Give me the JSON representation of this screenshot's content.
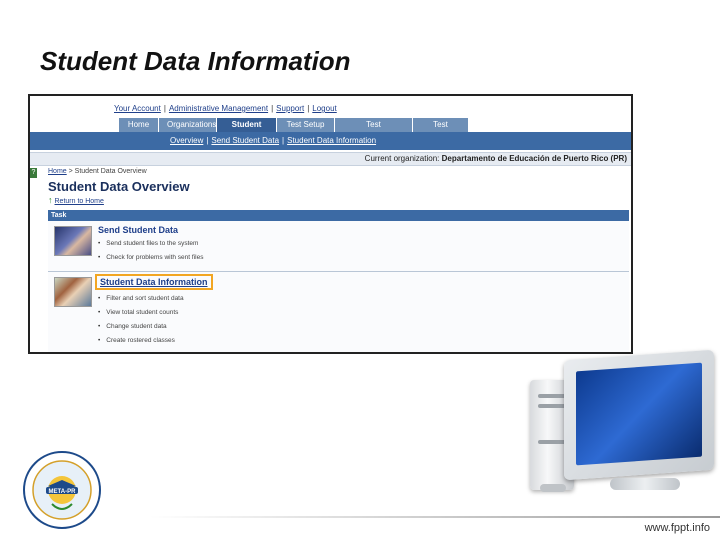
{
  "slide": {
    "title": "Student Data Information",
    "footer_url": "www.fppt.info"
  },
  "app": {
    "top_links": [
      "Your Account",
      "Administrative Management",
      "Support",
      "Logout"
    ],
    "tabs": [
      {
        "label": "Home",
        "active": false
      },
      {
        "label": "Organizations",
        "active": false
      },
      {
        "label": "Student Data",
        "active": true
      },
      {
        "label": "Test Setup",
        "active": false
      },
      {
        "label": "Test Management",
        "active": false
      },
      {
        "label": "Test Results",
        "active": false
      }
    ],
    "sub_nav": [
      "Overview",
      "Send Student Data",
      "Student Data Information"
    ],
    "org_label": "Current organization:",
    "org_value": "Departamento de Educación de Puerto Rico (PR)",
    "breadcrumb_home": "Home",
    "breadcrumb_rest": " > Student Data Overview",
    "page_heading": "Student Data Overview",
    "return_link": "Return to Home",
    "task_header": "Task",
    "rows": [
      {
        "title": "Send Student Data",
        "items": [
          "Send student files to the system",
          "Check for problems with sent files"
        ]
      },
      {
        "title": "Student Data Information",
        "items": [
          "Filter and sort student data",
          "View total student counts",
          "Change student data",
          "Create rostered classes"
        ]
      }
    ]
  },
  "colors": {
    "nav_blue": "#3c6aa4",
    "tab_active": "#355e95",
    "highlight_orange": "#f2a623"
  },
  "logo_text": "META-PR"
}
